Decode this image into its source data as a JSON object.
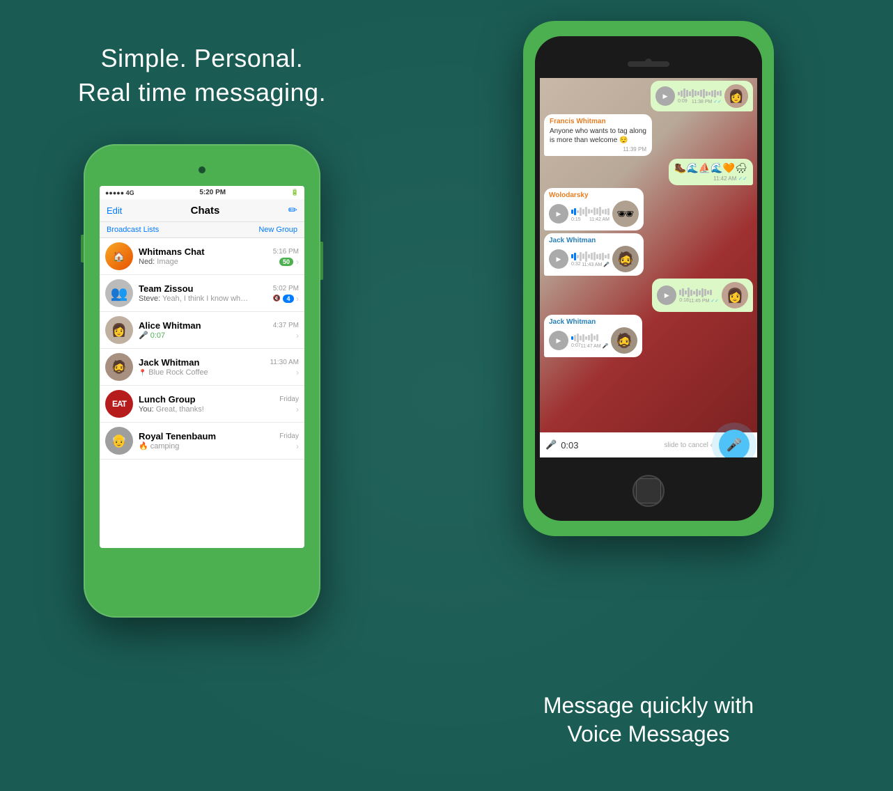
{
  "left": {
    "tagline_line1": "Simple. Personal.",
    "tagline_line2": "Real time messaging.",
    "status_bar": {
      "signal": "●●●●● 4G",
      "time": "5:20 PM",
      "battery": "█████"
    },
    "header": {
      "edit": "Edit",
      "title": "Chats",
      "compose_icon": "✏"
    },
    "broadcast_bar": {
      "broadcast": "Broadcast Lists",
      "new_group": "New Group"
    },
    "chats": [
      {
        "id": "whitmans-chat",
        "name": "Whitmans Chat",
        "time": "5:16 PM",
        "preview_label": "Ned:",
        "preview": "Image",
        "badge": "50",
        "avatar_type": "group",
        "avatar_label": "🏠"
      },
      {
        "id": "team-zissou",
        "name": "Team Zissou",
        "time": "5:02 PM",
        "preview_label": "Steve:",
        "preview": "Yeah, I think I know wha...",
        "badge": "4",
        "badge_type": "blue",
        "muted": true,
        "avatar_type": "person",
        "avatar_label": "👤"
      },
      {
        "id": "alice-whitman",
        "name": "Alice Whitman",
        "time": "4:37 PM",
        "preview": "🎤 0:07",
        "preview_green": true,
        "avatar_type": "person",
        "avatar_label": "👩"
      },
      {
        "id": "jack-whitman",
        "name": "Jack Whitman",
        "time": "11:30 AM",
        "location": "Blue Rock Coffee",
        "avatar_type": "person",
        "avatar_label": "🧔"
      },
      {
        "id": "lunch-group",
        "name": "Lunch Group",
        "time": "Friday",
        "preview_label": "You:",
        "preview": "Great, thanks!",
        "avatar_type": "group",
        "avatar_label": "EAT",
        "avatar_color": "red"
      },
      {
        "id": "royal-tenenbaum",
        "name": "Royal Tenenbaum",
        "time": "Friday",
        "preview": "🔥 camping",
        "avatar_type": "person",
        "avatar_label": "👴"
      }
    ]
  },
  "right": {
    "messages": [
      {
        "id": "msg1",
        "type": "voice-incoming",
        "sender": null,
        "has_thumb": true,
        "thumb_label": "👩",
        "duration": "0:09",
        "time": "11:38 PM",
        "check": true
      },
      {
        "id": "msg2",
        "type": "text-incoming",
        "sender": "Francis Whitman",
        "sender_color": "orange",
        "text": "Anyone who wants to tag along is more than welcome 😌",
        "time": "11:39 PM",
        "check": false
      },
      {
        "id": "msg3",
        "type": "emoji-outgoing",
        "text": "🥾🌊⛵🌊🧡🌧",
        "time": "11:42 AM",
        "check": true
      },
      {
        "id": "msg4",
        "type": "voice-incoming",
        "sender": "Wolodarsky",
        "sender_color": "orange",
        "has_thumb": true,
        "thumb_label": "🕶",
        "duration": "0:15",
        "time": "11:42 AM",
        "check": false
      },
      {
        "id": "msg5",
        "type": "voice-incoming",
        "sender": "Jack Whitman",
        "sender_color": "blue",
        "has_thumb": true,
        "thumb_label": "🧔",
        "duration": "0:32",
        "time": "11:43 AM",
        "check": false,
        "mic_blue": true
      },
      {
        "id": "msg6",
        "type": "voice-outgoing",
        "has_thumb": true,
        "thumb_label": "👩",
        "duration": "0:18",
        "time": "11:45 PM",
        "check": true
      },
      {
        "id": "msg7",
        "type": "voice-incoming",
        "sender": "Jack Whitman",
        "sender_color": "blue",
        "has_thumb": true,
        "thumb_label": "🧔",
        "duration": "0:07",
        "time": "11:47 AM",
        "check": false,
        "mic_blue": true
      }
    ],
    "recording": {
      "timer": "0:03",
      "slide_label": "slide to cancel ‹",
      "mic_icon": "🎤"
    },
    "bottom_tagline_line1": "Message quickly with",
    "bottom_tagline_line2": "Voice Messages"
  }
}
